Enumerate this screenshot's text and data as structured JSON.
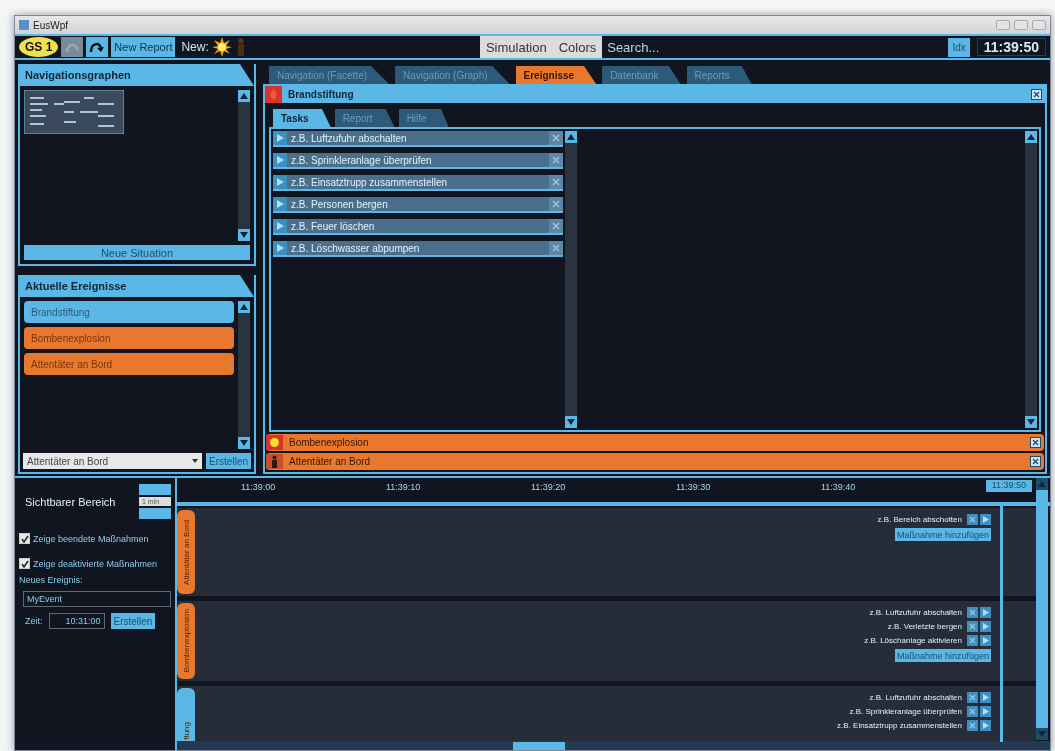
{
  "window": {
    "title": "EusWpf"
  },
  "toolbar": {
    "badge": "GS 1",
    "back_disabled": true,
    "new_report": "New Report",
    "new_label": "New:",
    "menu": [
      "Simulation",
      "Colors"
    ],
    "search": {
      "placeholder": "Search..."
    },
    "idx": "Idx",
    "clock": "11:39:50"
  },
  "nav_panel": {
    "title": "Navigationsgraphen",
    "button": "Neue Situation"
  },
  "events_panel": {
    "title": "Aktuelle Ereignisse",
    "items": [
      {
        "label": "Brandstiftung",
        "color": "#5bb8e6"
      },
      {
        "label": "Bombenexplosion",
        "color": "#e8782e"
      },
      {
        "label": "Attentäter an Bord",
        "color": "#e8782e"
      }
    ],
    "dropdown": "Attentäter an Bord",
    "button": "Erstellen"
  },
  "main_tabs": [
    {
      "label": "Navigation (Facette)",
      "selected": false
    },
    {
      "label": "Navigation (Graph)",
      "selected": false
    },
    {
      "label": "Ereignisse",
      "selected": true
    },
    {
      "label": "Datenbank",
      "selected": false
    },
    {
      "label": "Reports",
      "selected": false
    }
  ],
  "event_panes": [
    {
      "title": "Brandstiftung",
      "kind": "fire",
      "color": "#5bb8e6",
      "expanded": true,
      "tabs": [
        {
          "label": "Tasks",
          "selected": true
        },
        {
          "label": "Report",
          "selected": false
        },
        {
          "label": "Hilfe",
          "selected": false
        }
      ],
      "tasks": [
        "z.B. Luftzufuhr abschalten",
        "z.B. Sprinkleranlage überprüfen",
        "z.B. Einsatztrupp zusammenstellen",
        "z.B. Personen bergen",
        "z.B. Feuer löschen",
        "z.B. Löschwasser abpumpen"
      ]
    },
    {
      "title": "Bombenexplosion",
      "kind": "bomb",
      "color": "#e8782e",
      "expanded": false
    },
    {
      "title": "Attentäter an Bord",
      "kind": "attacker",
      "color": "#e8782e",
      "expanded": false
    }
  ],
  "timeline": {
    "range_label": "Sichtbarer Bereich",
    "range": "1 min",
    "checkboxes": [
      {
        "label": "Zeige beendete Maßnahmen",
        "checked": true
      },
      {
        "label": "Zeige deaktivierte Maßnahmen",
        "checked": true
      }
    ],
    "new_event_label": "Neues Ereignis:",
    "name": "MyEvent",
    "time_label": "Zeit:",
    "time": "10:31:00",
    "button": "Erstellen",
    "ticks": [
      "11:39:00",
      "11:39:10",
      "11:39:20",
      "11:39:30",
      "11:39:40"
    ],
    "now": "11:39:50",
    "lanes": [
      {
        "label": "Attentäter an Bord",
        "color": "#e8782e",
        "tasks": [
          "z.B. Bereich abschotten"
        ],
        "add_button": "Maßnahme hinzufügen"
      },
      {
        "label": "Bombenexplosion",
        "color": "#e8782e",
        "tasks": [
          "z.B. Luftzufuhr abschalten",
          "z.B. Verletzte bergen",
          "z.B. Löschanlage aktivieren"
        ],
        "add_button": "Maßnahme hinzufügen"
      },
      {
        "label": "ftung",
        "color": "#5bb8e6",
        "tasks": [
          "z.B. Luftzufuhr abschalten",
          "z.B. Sprinkleranlage überprüfen",
          "z.B. Einsatztrupp zusammenstellen"
        ]
      }
    ]
  }
}
